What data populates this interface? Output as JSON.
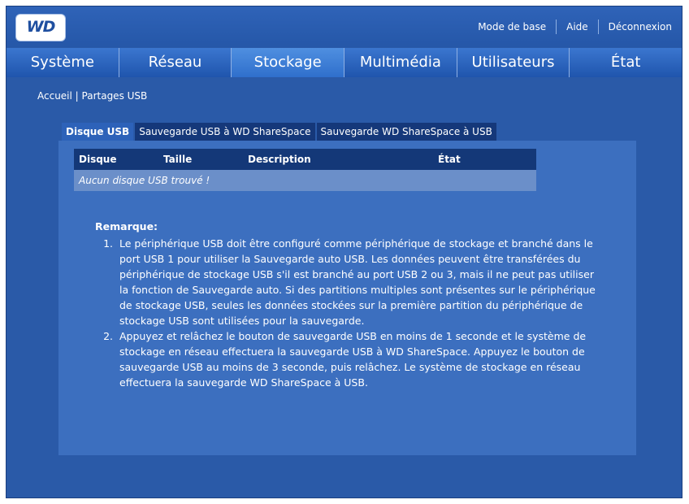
{
  "logo": {
    "text": "WD"
  },
  "top_links": [
    "Mode de base",
    "Aide",
    "Déconnexion"
  ],
  "main_tabs": [
    {
      "label": "Système",
      "active": false
    },
    {
      "label": "Réseau",
      "active": false
    },
    {
      "label": "Stockage",
      "active": true
    },
    {
      "label": "Multimédia",
      "active": false
    },
    {
      "label": "Utilisateurs",
      "active": false
    },
    {
      "label": "État",
      "active": false
    }
  ],
  "breadcrumb": "Accueil | Partages USB",
  "sub_tabs": [
    {
      "label": "Disque USB",
      "active": true
    },
    {
      "label": "Sauvegarde USB à WD ShareSpace",
      "active": false
    },
    {
      "label": "Sauvegarde WD ShareSpace à USB",
      "active": false
    }
  ],
  "table": {
    "columns": [
      "Disque",
      "Taille",
      "Description",
      "État"
    ],
    "empty_message": "Aucun disque USB trouvé !"
  },
  "notes": {
    "title": "Remarque:",
    "items": [
      "Le périphérique USB doit être configuré comme périphérique de stockage et branché dans le port USB 1 pour utiliser la Sauvegarde auto USB. Les données peuvent être transférées du périphérique de stockage USB s'il est branché au port USB 2 ou 3, mais il ne peut pas utiliser la fonction de Sauvegarde auto. Si des partitions multiples sont présentes sur le périphérique de stockage USB, seules les données stockées sur la première partition du périphérique de stockage USB sont utilisées pour la sauvegarde.",
      "Appuyez et relâchez le bouton de sauvegarde USB en moins de 1 seconde et le système de stockage en réseau effectuera la sauvegarde USB à WD ShareSpace. Appuyez le bouton de sauvegarde USB au moins de 3 seconde, puis relâchez. Le système de stockage en réseau effectuera la sauvegarde WD ShareSpace à USB."
    ]
  }
}
